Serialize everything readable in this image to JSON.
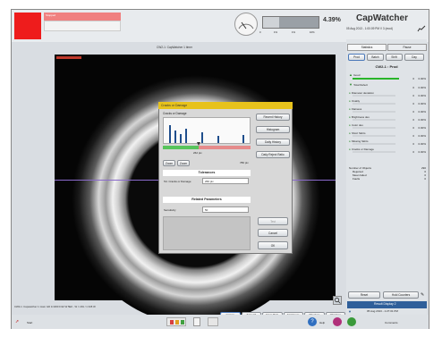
{
  "status": {
    "label": "Stopped",
    "percent": "4.39%",
    "hist_ticks": [
      "0",
      "1%",
      "1%",
      "10%"
    ]
  },
  "app": {
    "name": "CapWatcher",
    "datetime": "05 Aug 2013 - 1:00:09 PM  V 3 (mod)"
  },
  "view": {
    "title": "CW2-1: CapWatcher 1 timer"
  },
  "right_panel": {
    "tabs": [
      "Statistics",
      "Pause"
    ],
    "subtabs": [
      "Prod",
      "Batch",
      "Shift",
      "Day"
    ],
    "header": "CW2-1 : Prod",
    "stats": [
      {
        "label": "Good",
        "v1": "0",
        "v2": "0.00%"
      },
      {
        "label": "Total Defect",
        "v1": "0",
        "v2": "0.00%"
      },
      {
        "label": "Diameter deviation",
        "v1": "0",
        "v2": "0.00%"
      },
      {
        "label": "Ovality",
        "v1": "0",
        "v2": "0.00%"
      },
      {
        "label": "Flatness",
        "v1": "0",
        "v2": "0.00%"
      },
      {
        "label": "Brightness dev.",
        "v1": "0",
        "v2": "0.00%"
      },
      {
        "label": "Color dev.",
        "v1": "0",
        "v2": "0.00%"
      },
      {
        "label": "Short Skirts",
        "v1": "0",
        "v2": "0.00%"
      },
      {
        "label": "Missing Skirts",
        "v1": "0",
        "v2": "0.00%"
      },
      {
        "label": "Cracks or Damage",
        "v1": "0",
        "v2": "0.00%"
      }
    ],
    "summary": [
      {
        "label": "Number of Objects",
        "value": "290"
      },
      {
        "label": "Rejected",
        "value": "0"
      },
      {
        "label": "Mean failed",
        "value": "0"
      },
      {
        "label": "Faults",
        "value": "0"
      }
    ],
    "reset_btn": "Reset",
    "hold_btn": "Hold Counters",
    "result_label": "Result Display 2",
    "result_datetime": "05 Aug 2013 - 1:27:01 PM"
  },
  "dialog": {
    "title": "Cracks or Damage",
    "chart_title": "Cracks or Damage",
    "value_label": "262 pix",
    "range_right": "780 pix",
    "zoom_in": "Zoom",
    "zoom_out": "Zoom",
    "buttons": [
      "Recent History",
      "Histogram",
      "Daily History",
      "Daily Reject Ratio"
    ],
    "tolerances_title": "Tolerances",
    "tolerance_label": "Tol. Cracks or Damage",
    "tolerance_value": "260 pix",
    "related_title": "Related Parameters",
    "sensitivity_label": "Sensitivity",
    "sensitivity_value": "50",
    "test_btn": "Test",
    "cancel_btn": "Cancel",
    "ok_btn": "OK"
  },
  "bottom": {
    "info": "CW2-1: Capwatcher 1 1cam GD 1/1000 F/22 W 5E0 - W = 291 / 1 345 W",
    "tabs": [
      "Camera",
      "Setup All",
      "Setup Mode",
      "Scroll Lines",
      "Objectives",
      "Objectives"
    ],
    "start_label": "Start",
    "help_label": "Help",
    "lang_label": "Comments"
  }
}
